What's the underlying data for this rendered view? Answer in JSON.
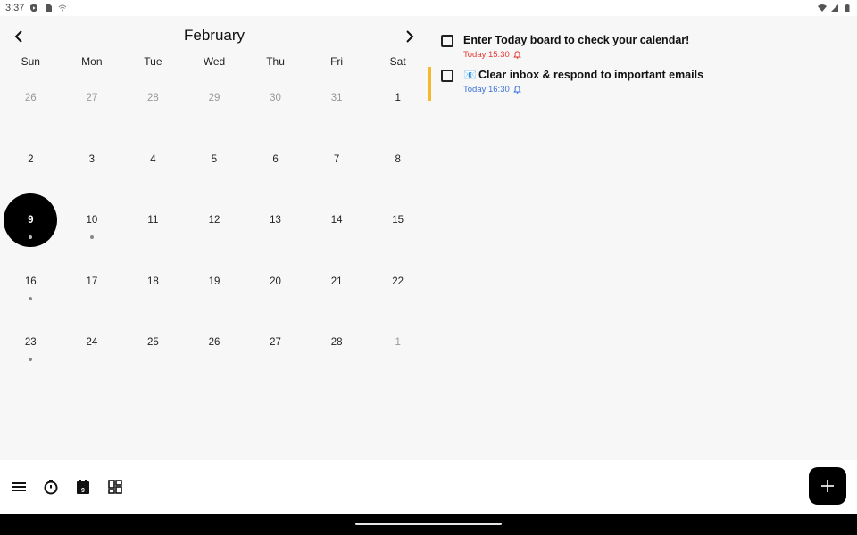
{
  "status_bar": {
    "time": "3:37",
    "left_icons": [
      "shield-play-icon",
      "sim-card-icon",
      "wifi-assist-icon"
    ],
    "right_icons": [
      "wifi-icon",
      "signal-icon",
      "battery-icon"
    ]
  },
  "calendar": {
    "month": "February",
    "weekdays": [
      "Sun",
      "Mon",
      "Tue",
      "Wed",
      "Thu",
      "Fri",
      "Sat"
    ],
    "weeks": [
      [
        {
          "d": "26",
          "other": true
        },
        {
          "d": "27",
          "other": true
        },
        {
          "d": "28",
          "other": true
        },
        {
          "d": "29",
          "other": true
        },
        {
          "d": "30",
          "other": true
        },
        {
          "d": "31",
          "other": true
        },
        {
          "d": "1"
        }
      ],
      [
        {
          "d": "2"
        },
        {
          "d": "3"
        },
        {
          "d": "4"
        },
        {
          "d": "5"
        },
        {
          "d": "6"
        },
        {
          "d": "7"
        },
        {
          "d": "8"
        }
      ],
      [
        {
          "d": "9",
          "selected": true,
          "dot": true
        },
        {
          "d": "10",
          "dot": true
        },
        {
          "d": "11"
        },
        {
          "d": "12"
        },
        {
          "d": "13"
        },
        {
          "d": "14"
        },
        {
          "d": "15"
        }
      ],
      [
        {
          "d": "16",
          "dot": true
        },
        {
          "d": "17"
        },
        {
          "d": "18"
        },
        {
          "d": "19"
        },
        {
          "d": "20"
        },
        {
          "d": "21"
        },
        {
          "d": "22"
        }
      ],
      [
        {
          "d": "23",
          "dot": true
        },
        {
          "d": "24"
        },
        {
          "d": "25"
        },
        {
          "d": "26"
        },
        {
          "d": "27"
        },
        {
          "d": "28"
        },
        {
          "d": "1",
          "other": true
        }
      ]
    ]
  },
  "tasks": [
    {
      "title": "Enter Today board to check your calendar!",
      "emoji": "",
      "time": "Today 15:30",
      "time_color": "#e53935",
      "accent": false
    },
    {
      "title": "Clear inbox & respond to important emails",
      "emoji": "📧",
      "time": "Today 16:30",
      "time_color": "#3b73d9",
      "accent": true
    }
  ],
  "bottom_bar": {
    "icons": [
      "menu-icon",
      "timer-icon",
      "calendar-icon",
      "dashboard-icon"
    ],
    "calendar_icon_day": "9",
    "fab": "add-icon"
  },
  "colors": {
    "accent": "#f5b82e",
    "background": "#f7f7f7",
    "selected_day": "#000000"
  }
}
